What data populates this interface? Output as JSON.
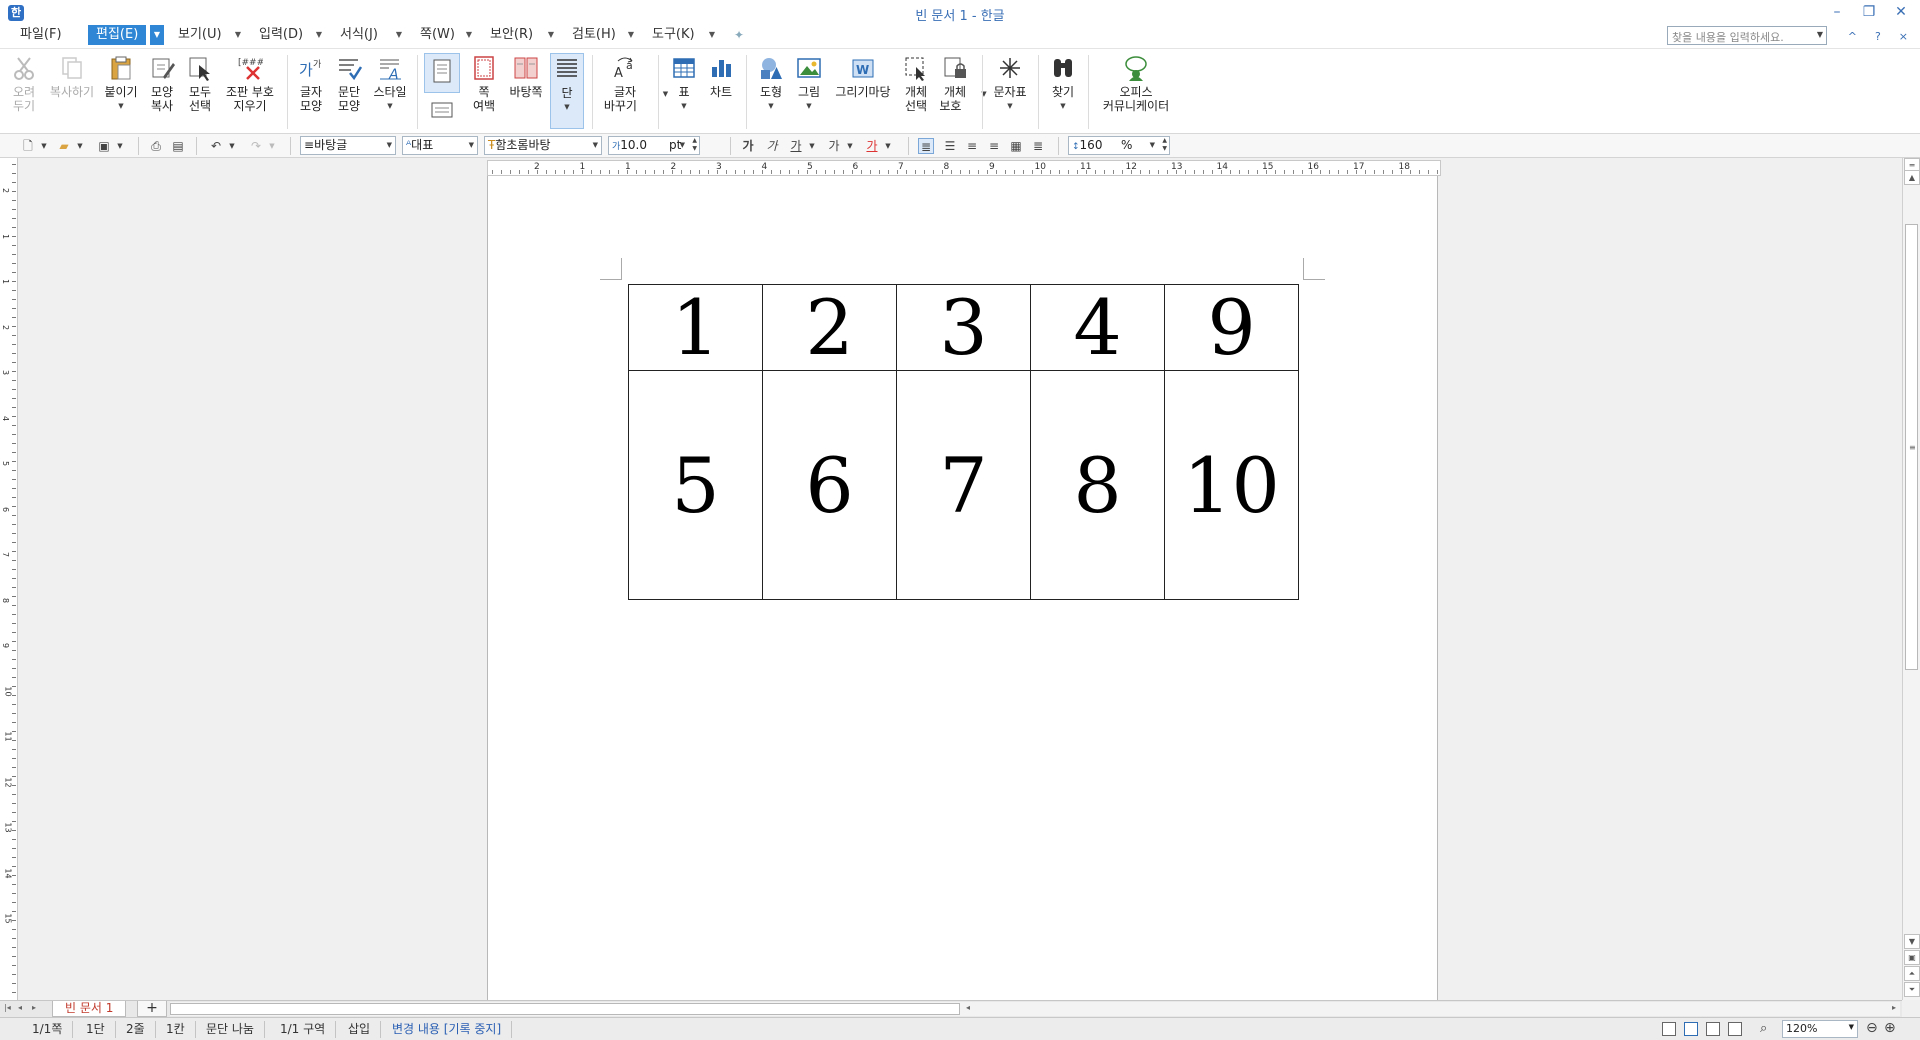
{
  "window": {
    "title": "빈 문서 1 - 한글",
    "app_icon_glyph": "한",
    "controls": [
      "–",
      "❐",
      "✕"
    ]
  },
  "menu": {
    "items": [
      "파일(F)",
      "편집(E)",
      "보기(U)",
      "입력(D)",
      "서식(J)",
      "쪽(W)",
      "보안(R)",
      "검토(H)",
      "도구(K)"
    ],
    "active_index": 1,
    "search_placeholder": "찾을 내용을 입력하세요.",
    "mini_buttons": [
      "^",
      "?",
      "×"
    ]
  },
  "ribbon": {
    "cut": "오려\n두기",
    "copy": "복사하기",
    "paste": "붙이기",
    "format_copy": "모양\n복사",
    "select_all": "모두\n선택",
    "clear_marks": "조판 부호\n지우기",
    "char_shape": "글자\n모양",
    "para_shape": "문단\n모양",
    "style": "스타일",
    "page_margin": "쪽\n여백",
    "background": "바탕쪽",
    "column": "단",
    "change_case": "글자\n바꾸기",
    "table": "표",
    "chart": "차트",
    "shape": "도형",
    "picture": "그림",
    "drawing_market": "그리기마당",
    "object_select": "개체\n선택",
    "object_protect": "개체\n보호",
    "symbols": "문자표",
    "find": "찾기",
    "office_comm": "오피스\n커뮤니케이터"
  },
  "format_toolbar": {
    "style": "바탕글",
    "lang": "대표",
    "font": "함초롬바탕",
    "size": "10.0",
    "size_unit": "pt",
    "char_btns": [
      "가",
      "가",
      "가",
      "가",
      "가"
    ],
    "line_spacing": "160",
    "line_spacing_unit": "%"
  },
  "ruler": {
    "h_labels": [
      "2",
      "1",
      "1",
      "2",
      "3",
      "4",
      "5",
      "6",
      "7",
      "8",
      "9",
      "10",
      "11",
      "12",
      "13",
      "14",
      "15",
      "16",
      "17",
      "18"
    ],
    "v_labels": [
      "2",
      "1",
      "1",
      "2",
      "3",
      "4",
      "5",
      "6",
      "7",
      "8",
      "9",
      "10",
      "11",
      "12",
      "13",
      "14",
      "15"
    ]
  },
  "document": {
    "table_rows": [
      [
        "1",
        "2",
        "3",
        "4",
        "9"
      ],
      [
        "5",
        "6",
        "7",
        "8",
        "10"
      ]
    ]
  },
  "tabs": {
    "doc_tab": "빈 문서 1",
    "add_label": "+"
  },
  "status": {
    "page": "1/1쪽",
    "column": "1단",
    "line": "2줄",
    "col": "1칸",
    "break": "문단 나눔",
    "section": "1/1 구역",
    "mode": "삽입",
    "track": "변경 내용 [기록 중지]",
    "zoom": "120%"
  }
}
